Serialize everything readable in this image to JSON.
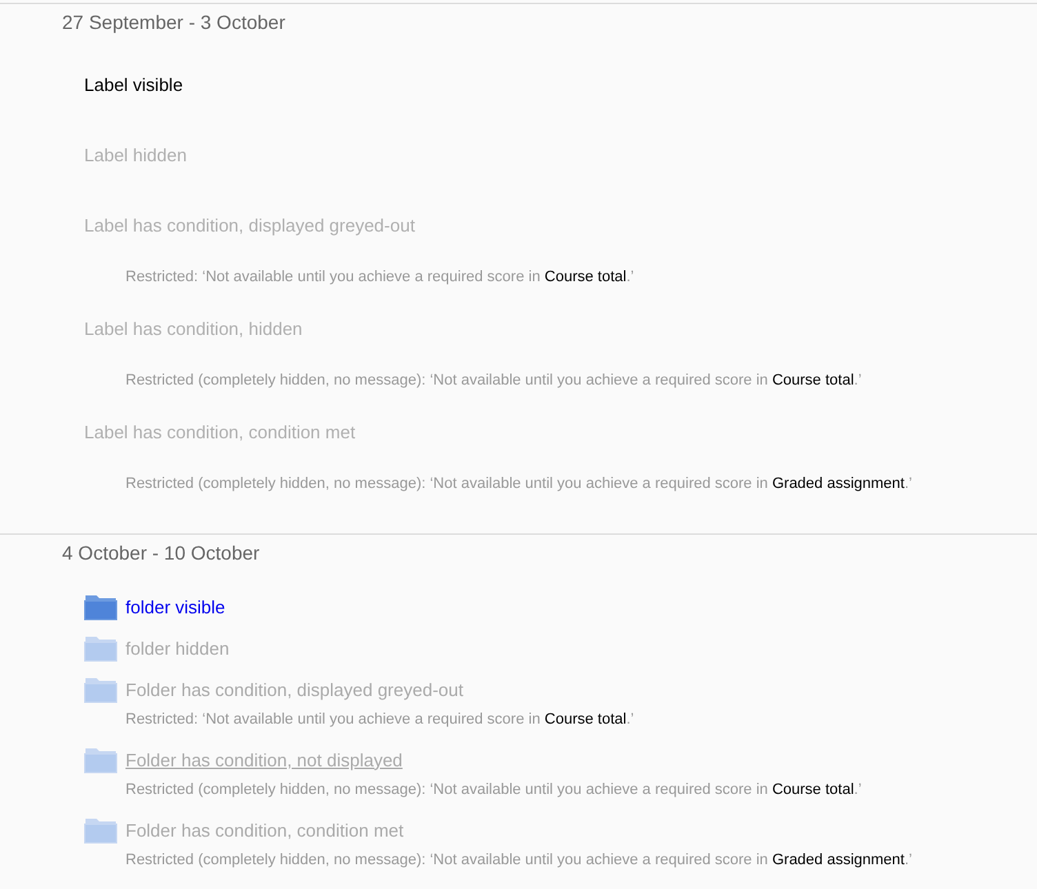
{
  "sections": [
    {
      "title": "27 September - 3 October",
      "items": [
        {
          "kind": "label",
          "text": "Label visible",
          "dimmed": false
        },
        {
          "kind": "label",
          "text": "Label hidden",
          "dimmed": true
        },
        {
          "kind": "label",
          "text": "Label has condition, displayed greyed-out",
          "dimmed": true,
          "restriction": {
            "text": "Restricted: ‘Not available until you achieve a required score in",
            "link": "Course total",
            "end": ".’"
          }
        },
        {
          "kind": "label",
          "text": "Label has condition, hidden",
          "dimmed": true,
          "restriction": {
            "text": "Restricted (completely hidden, no message): ‘Not available until you achieve a required score in",
            "link": "Course total",
            "end": ".’"
          }
        },
        {
          "kind": "label",
          "text": "Label has condition, condition met",
          "dimmed": true,
          "restriction": {
            "text": "Restricted (completely hidden, no message): ‘Not available until you achieve a required score in",
            "link": "Graded assignment",
            "end": ".’"
          }
        }
      ]
    },
    {
      "title": "4 October - 10 October",
      "items": [
        {
          "kind": "folder",
          "text": "folder visible",
          "dimmed": false,
          "underlined": false
        },
        {
          "kind": "folder",
          "text": "folder hidden",
          "dimmed": true,
          "underlined": false
        },
        {
          "kind": "folder",
          "text": "Folder has condition, displayed greyed-out",
          "dimmed": true,
          "underlined": false,
          "restriction": {
            "text": "Restricted: ‘Not available until you achieve a required score in",
            "link": "Course total",
            "end": ".’"
          }
        },
        {
          "kind": "folder",
          "text": "Folder has condition, not displayed",
          "dimmed": true,
          "underlined": true,
          "restriction": {
            "text": "Restricted (completely hidden, no message): ‘Not available until you achieve a required score in",
            "link": "Course total",
            "end": ".’"
          }
        },
        {
          "kind": "folder",
          "text": "Folder has condition, condition met",
          "dimmed": true,
          "underlined": false,
          "restriction": {
            "text": "Restricted (completely hidden, no message): ‘Not available until you achieve a required score in",
            "link": "Graded assignment",
            "end": ".’"
          }
        }
      ]
    }
  ]
}
